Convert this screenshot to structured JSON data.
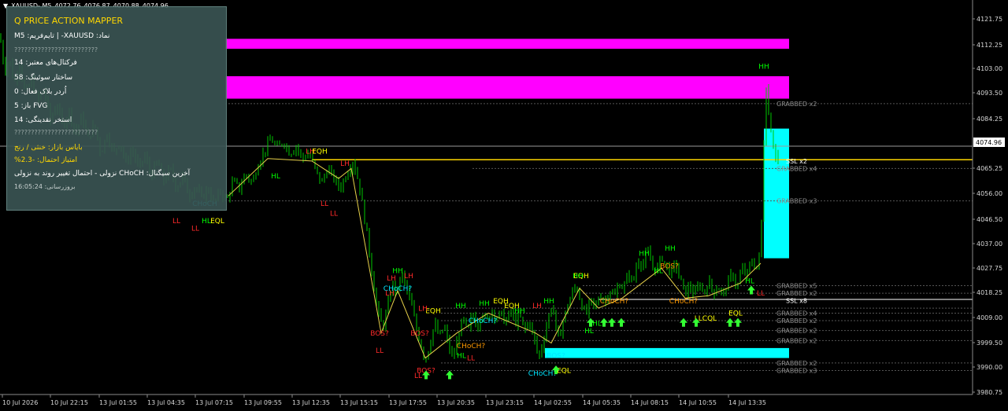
{
  "chart_header": {
    "arrow": "▼",
    "symbol": "XAUUSD-,M5",
    "ohlc": [
      "4072.76",
      "4076.87",
      "4070.88",
      "4074.96"
    ]
  },
  "panel": {
    "title": "Q PRICE ACTION MAPPER",
    "symbol_line": "نماد: XAUUSD-  |  تایم‌فریم: M5",
    "separator": "?????????????????????????",
    "fractals": "فرکتال‌های معتبر: 14",
    "swing": "ساختار سوئینگ: 58",
    "order_block": "اُردر بلاک فعال: 0",
    "fvg": "FVG باز: 5",
    "liquidity": "استخر نقدینگی: 14",
    "bias": "بایاس بازار: خنثی / رنج",
    "score": "امتیاز احتمال: -2.3%",
    "last_signal": "آخرین سیگنال: CHoCH نزولی - احتمال تغییر روند به نزولی",
    "updated": "بروزرسانی: 16:05:24"
  },
  "chart_data": {
    "type": "candlestick",
    "ylim": [
      3976,
      4126
    ],
    "price_ticks": [
      "4121.75",
      "4112.25",
      "4103.00",
      "4093.50",
      "4084.25",
      "4074.96",
      "4065.25",
      "4056.00",
      "4046.50",
      "4037.00",
      "4027.75",
      "4018.25",
      "4009.00",
      "3999.50",
      "3990.00",
      "3980.75"
    ],
    "current_price": "4074.96",
    "time_ticks": [
      "10 Jul 2026",
      "10 Jul 22:15",
      "13 Jul 01:55",
      "13 Jul 04:35",
      "13 Jul 07:15",
      "13 Jul 09:55",
      "13 Jul 12:35",
      "13 Jul 15:15",
      "13 Jul 17:55",
      "13 Jul 20:35",
      "13 Jul 23:15",
      "14 Jul 02:55",
      "14 Jul 05:35",
      "14 Jul 08:15",
      "14 Jul 10:55",
      "14 Jul 13:35"
    ],
    "colors": {
      "candle": "#00c800",
      "zone_supply": "#ff00ff",
      "zone_demand": "#00ffff",
      "level": "#ffd700",
      "label_hh": "#00ff00",
      "label_ll": "#ff2a2a",
      "label_eq": "#ffff00",
      "label_bos": "#ff2a2a",
      "label_choch": "#00e5ff",
      "label_orange": "#ff9900",
      "label_gray": "#8c8c8c"
    },
    "price_path": [
      [
        0,
        4119
      ],
      [
        6,
        4105
      ],
      [
        12,
        4110
      ],
      [
        18,
        4100
      ],
      [
        25,
        4108
      ],
      [
        32,
        4096
      ],
      [
        40,
        4101
      ],
      [
        48,
        4093
      ],
      [
        56,
        4098
      ],
      [
        64,
        4085
      ],
      [
        72,
        4092
      ],
      [
        80,
        4083
      ],
      [
        88,
        4089
      ],
      [
        96,
        4080
      ],
      [
        104,
        4087
      ],
      [
        112,
        4078
      ],
      [
        120,
        4084
      ],
      [
        128,
        4072
      ],
      [
        136,
        4080
      ],
      [
        144,
        4072
      ],
      [
        152,
        4077
      ],
      [
        160,
        4068
      ],
      [
        168,
        4074
      ],
      [
        176,
        4066
      ],
      [
        184,
        4071
      ],
      [
        192,
        4063
      ],
      [
        200,
        4069
      ],
      [
        208,
        4061
      ],
      [
        216,
        4066
      ],
      [
        224,
        4058
      ],
      [
        232,
        4063
      ],
      [
        240,
        4055
      ],
      [
        248,
        4059
      ],
      [
        256,
        4054
      ],
      [
        264,
        4058
      ],
      [
        272,
        4052
      ],
      [
        280,
        4057
      ],
      [
        288,
        4053
      ],
      [
        296,
        4061
      ],
      [
        304,
        4058
      ],
      [
        312,
        4064
      ],
      [
        320,
        4060
      ],
      [
        328,
        4068
      ],
      [
        336,
        4073
      ],
      [
        344,
        4078
      ],
      [
        352,
        4074
      ],
      [
        360,
        4077
      ],
      [
        368,
        4072
      ],
      [
        376,
        4075
      ],
      [
        384,
        4070
      ],
      [
        392,
        4072
      ],
      [
        400,
        4066
      ],
      [
        408,
        4060
      ],
      [
        416,
        4066
      ],
      [
        424,
        4062
      ],
      [
        432,
        4058
      ],
      [
        440,
        4064
      ],
      [
        448,
        4069
      ],
      [
        456,
        4060
      ],
      [
        462,
        4048
      ],
      [
        468,
        4035
      ],
      [
        474,
        4020
      ],
      [
        480,
        4008
      ],
      [
        486,
        4002
      ],
      [
        492,
        4010
      ],
      [
        498,
        4020
      ],
      [
        504,
        4016
      ],
      [
        510,
        4024
      ],
      [
        516,
        4018
      ],
      [
        522,
        4012
      ],
      [
        528,
        4003
      ],
      [
        534,
        3996
      ],
      [
        540,
        3989
      ],
      [
        546,
        3996
      ],
      [
        552,
        4004
      ],
      [
        558,
        3998
      ],
      [
        564,
        4003
      ],
      [
        570,
        3994
      ],
      [
        576,
        3990
      ],
      [
        582,
        3999
      ],
      [
        588,
        4006
      ],
      [
        594,
        4000
      ],
      [
        600,
        4008
      ],
      [
        606,
        4002
      ],
      [
        612,
        4009
      ],
      [
        618,
        4004
      ],
      [
        624,
        4010
      ],
      [
        630,
        4006
      ],
      [
        636,
        4008
      ],
      [
        642,
        4004
      ],
      [
        648,
        4009
      ],
      [
        654,
        4004
      ],
      [
        660,
        4007
      ],
      [
        666,
        4001
      ],
      [
        672,
        4005
      ],
      [
        678,
        3998
      ],
      [
        684,
        3990
      ],
      [
        690,
        3997
      ],
      [
        696,
        4006
      ],
      [
        702,
        4012
      ],
      [
        708,
        3996
      ],
      [
        714,
        4004
      ],
      [
        720,
        4010
      ],
      [
        726,
        4016
      ],
      [
        732,
        4019
      ],
      [
        738,
        4012
      ],
      [
        744,
        4007
      ],
      [
        750,
        4013
      ],
      [
        756,
        4010
      ],
      [
        762,
        4016
      ],
      [
        768,
        4012
      ],
      [
        774,
        4018
      ],
      [
        780,
        4014
      ],
      [
        786,
        4020
      ],
      [
        792,
        4018
      ],
      [
        798,
        4024
      ],
      [
        804,
        4020
      ],
      [
        810,
        4030
      ],
      [
        816,
        4027
      ],
      [
        822,
        4033
      ],
      [
        828,
        4027
      ],
      [
        834,
        4025
      ],
      [
        840,
        4031
      ],
      [
        846,
        4027
      ],
      [
        852,
        4024
      ],
      [
        858,
        4028
      ],
      [
        864,
        4021
      ],
      [
        870,
        4016
      ],
      [
        876,
        4019
      ],
      [
        882,
        4015
      ],
      [
        888,
        4020
      ],
      [
        894,
        4016
      ],
      [
        900,
        4021
      ],
      [
        906,
        4016
      ],
      [
        912,
        4019
      ],
      [
        918,
        4015
      ],
      [
        924,
        4020
      ],
      [
        930,
        4024
      ],
      [
        936,
        4018
      ],
      [
        942,
        4026
      ],
      [
        948,
        4023
      ],
      [
        954,
        4029
      ],
      [
        960,
        4026
      ],
      [
        964,
        4030
      ],
      [
        968,
        4050
      ],
      [
        972,
        4103
      ],
      [
        976,
        4088
      ],
      [
        980,
        4080
      ],
      [
        984,
        4070
      ],
      [
        988,
        4073
      ]
    ],
    "zones": [
      {
        "type": "supply",
        "from_x": 286,
        "to_x": 1002,
        "top": 4118,
        "bottom": 4114
      },
      {
        "type": "supply",
        "from_x": 286,
        "to_x": 1002,
        "top": 4103,
        "bottom": 4094
      },
      {
        "type": "demand",
        "from_x": 970,
        "to_x": 1002,
        "top": 4082,
        "bottom": 4030
      },
      {
        "type": "demand",
        "from_x": 692,
        "to_x": 1002,
        "top": 3994,
        "bottom": 3990
      }
    ],
    "level_lines": [
      {
        "price": 4069.5,
        "from_x": 396,
        "to_x": 1002,
        "color": "#ffd700"
      },
      {
        "price": 4013.5,
        "from_x": 760,
        "to_x": 1002,
        "color": "#ffffff"
      }
    ],
    "dashed_lines": [
      {
        "price": 4092,
        "from_x": 286,
        "label": "GRABBED x2"
      },
      {
        "price": 4066,
        "from_x": 600,
        "label": "GRABBED x4"
      },
      {
        "price": 4053,
        "from_x": 286,
        "label": "GRABBED x3"
      },
      {
        "price": 4019,
        "from_x": 740,
        "label": "GRABBED x5"
      },
      {
        "price": 4016,
        "from_x": 740,
        "label": "GRABBED x2"
      },
      {
        "price": 4010,
        "from_x": 560,
        "label": ""
      },
      {
        "price": 4008,
        "from_x": 560,
        "label": "GRABBED x4"
      },
      {
        "price": 4005,
        "from_x": 560,
        "label": "GRABBED x2"
      },
      {
        "price": 4001,
        "from_x": 560,
        "label": "GRABBED x2"
      },
      {
        "price": 3997,
        "from_x": 560,
        "label": "GRABBED x2"
      },
      {
        "price": 3988,
        "from_x": 560,
        "label": "GRABBED x2"
      },
      {
        "price": 3985,
        "from_x": 560,
        "label": "GRABBED x3"
      }
    ],
    "side_labels": [
      {
        "price": 4069,
        "text": "SSL x2",
        "color": "#ffffff"
      },
      {
        "price": 4013,
        "text": "SSL x8",
        "color": "#ffffff"
      }
    ],
    "structure_path": [
      [
        290,
        4055
      ],
      [
        340,
        4070
      ],
      [
        396,
        4069
      ],
      [
        430,
        4062
      ],
      [
        446,
        4066
      ],
      [
        484,
        4000
      ],
      [
        505,
        4017
      ],
      [
        540,
        3990
      ],
      [
        580,
        4000
      ],
      [
        620,
        4008
      ],
      [
        680,
        4000
      ],
      [
        700,
        3996
      ],
      [
        736,
        4018
      ],
      [
        760,
        4010
      ],
      [
        790,
        4014
      ],
      [
        840,
        4026
      ],
      [
        870,
        4014
      ],
      [
        900,
        4015
      ],
      [
        940,
        4020
      ],
      [
        966,
        4028
      ]
    ],
    "annotations": [
      {
        "t": "HH",
        "x": 970,
        "p": 4106,
        "c": "label_hh"
      },
      {
        "t": "HL",
        "x": 350,
        "p": 4062,
        "c": "label_hh"
      },
      {
        "t": "LL",
        "x": 224,
        "p": 4044,
        "c": "label_ll"
      },
      {
        "t": "LL",
        "x": 248,
        "p": 4041,
        "c": "label_ll"
      },
      {
        "t": "HL",
        "x": 262,
        "p": 4044,
        "c": "label_hh"
      },
      {
        "t": "EQL",
        "x": 276,
        "p": 4044,
        "c": "label_eq"
      },
      {
        "t": "CHoCH",
        "x": 260,
        "p": 4051,
        "c": "label_choch"
      },
      {
        "t": "LH",
        "x": 394,
        "p": 4072,
        "c": "label_ll"
      },
      {
        "t": "EQH",
        "x": 406,
        "p": 4072,
        "c": "label_eq"
      },
      {
        "t": "LH",
        "x": 438,
        "p": 4067,
        "c": "label_ll"
      },
      {
        "t": "LL",
        "x": 412,
        "p": 4051,
        "c": "label_ll"
      },
      {
        "t": "LL",
        "x": 424,
        "p": 4047,
        "c": "label_ll"
      },
      {
        "t": "HH",
        "x": 505,
        "p": 4024,
        "c": "label_hh"
      },
      {
        "t": "LH",
        "x": 497,
        "p": 4021,
        "c": "label_ll"
      },
      {
        "t": "LH",
        "x": 519,
        "p": 4022,
        "c": "label_ll"
      },
      {
        "t": "CHoCH?",
        "x": 505,
        "p": 4017,
        "c": "label_choch"
      },
      {
        "t": "LH",
        "x": 495,
        "p": 4015,
        "c": "label_ll"
      },
      {
        "t": "BOS?",
        "x": 482,
        "p": 3999,
        "c": "label_bos"
      },
      {
        "t": "BOS?",
        "x": 533,
        "p": 3999,
        "c": "label_bos"
      },
      {
        "t": "LL",
        "x": 482,
        "p": 3992,
        "c": "label_ll"
      },
      {
        "t": "EQH",
        "x": 550,
        "p": 4008,
        "c": "label_eq"
      },
      {
        "t": "LH",
        "x": 537,
        "p": 4009,
        "c": "label_ll"
      },
      {
        "t": "CHoCH?",
        "x": 613,
        "p": 4004,
        "c": "label_choch"
      },
      {
        "t": "HH",
        "x": 585,
        "p": 4010,
        "c": "label_hh"
      },
      {
        "t": "HH",
        "x": 615,
        "p": 4011,
        "c": "label_hh"
      },
      {
        "t": "EQH",
        "x": 636,
        "p": 4012,
        "c": "label_eq"
      },
      {
        "t": "EQH",
        "x": 650,
        "p": 4010,
        "c": "label_eq"
      },
      {
        "t": "HH",
        "x": 660,
        "p": 4008,
        "c": "label_hh"
      },
      {
        "t": "LH",
        "x": 682,
        "p": 4010,
        "c": "label_ll"
      },
      {
        "t": "HH",
        "x": 697,
        "p": 4012,
        "c": "label_hh"
      },
      {
        "t": "CHoCH?",
        "x": 598,
        "p": 3994,
        "c": "label_orange"
      },
      {
        "t": "HL",
        "x": 586,
        "p": 3990,
        "c": "label_hh"
      },
      {
        "t": "LL",
        "x": 598,
        "p": 3989,
        "c": "label_ll"
      },
      {
        "t": "BOS?",
        "x": 541,
        "p": 3984,
        "c": "label_bos"
      },
      {
        "t": "LL",
        "x": 531,
        "p": 3982,
        "c": "label_ll"
      },
      {
        "t": "BOS?",
        "x": 706,
        "p": 3990,
        "c": "label_choch"
      },
      {
        "t": "CHoCH?",
        "x": 689,
        "p": 3983,
        "c": "label_choch"
      },
      {
        "t": "EQL",
        "x": 716,
        "p": 3984,
        "c": "label_eq"
      },
      {
        "t": "EQH",
        "x": 738,
        "p": 4022,
        "c": "label_eq"
      },
      {
        "t": "HH",
        "x": 734,
        "p": 4022,
        "c": "label_hh"
      },
      {
        "t": "CHoCH?",
        "x": 780,
        "p": 4012,
        "c": "label_orange"
      },
      {
        "t": "HL",
        "x": 758,
        "p": 4003,
        "c": "label_hh"
      },
      {
        "t": "HL",
        "x": 748,
        "p": 4000,
        "c": "label_hh"
      },
      {
        "t": "HH",
        "x": 818,
        "p": 4031,
        "c": "label_hh"
      },
      {
        "t": "HH",
        "x": 851,
        "p": 4033,
        "c": "label_hh"
      },
      {
        "t": "BOS?",
        "x": 850,
        "p": 4026,
        "c": "label_orange"
      },
      {
        "t": "HL",
        "x": 836,
        "p": 4024,
        "c": "label_hh"
      },
      {
        "t": "CHoCH?",
        "x": 868,
        "p": 4012,
        "c": "label_orange"
      },
      {
        "t": "LLCQL",
        "x": 896,
        "p": 4005,
        "c": "label_eq"
      },
      {
        "t": "EQL",
        "x": 934,
        "p": 4007,
        "c": "label_eq"
      },
      {
        "t": "HL",
        "x": 952,
        "p": 4020,
        "c": "label_hh"
      },
      {
        "t": "LL",
        "x": 966,
        "p": 4015,
        "c": "label_ll"
      }
    ],
    "arrows_up": [
      [
        541,
        3985
      ],
      [
        571,
        3985
      ],
      [
        706,
        3987
      ],
      [
        750,
        4006
      ],
      [
        767,
        4006
      ],
      [
        777,
        4006
      ],
      [
        789,
        4006
      ],
      [
        868,
        4006
      ],
      [
        884,
        4006
      ],
      [
        927,
        4006
      ],
      [
        937,
        4006
      ],
      [
        954,
        4019
      ]
    ]
  }
}
